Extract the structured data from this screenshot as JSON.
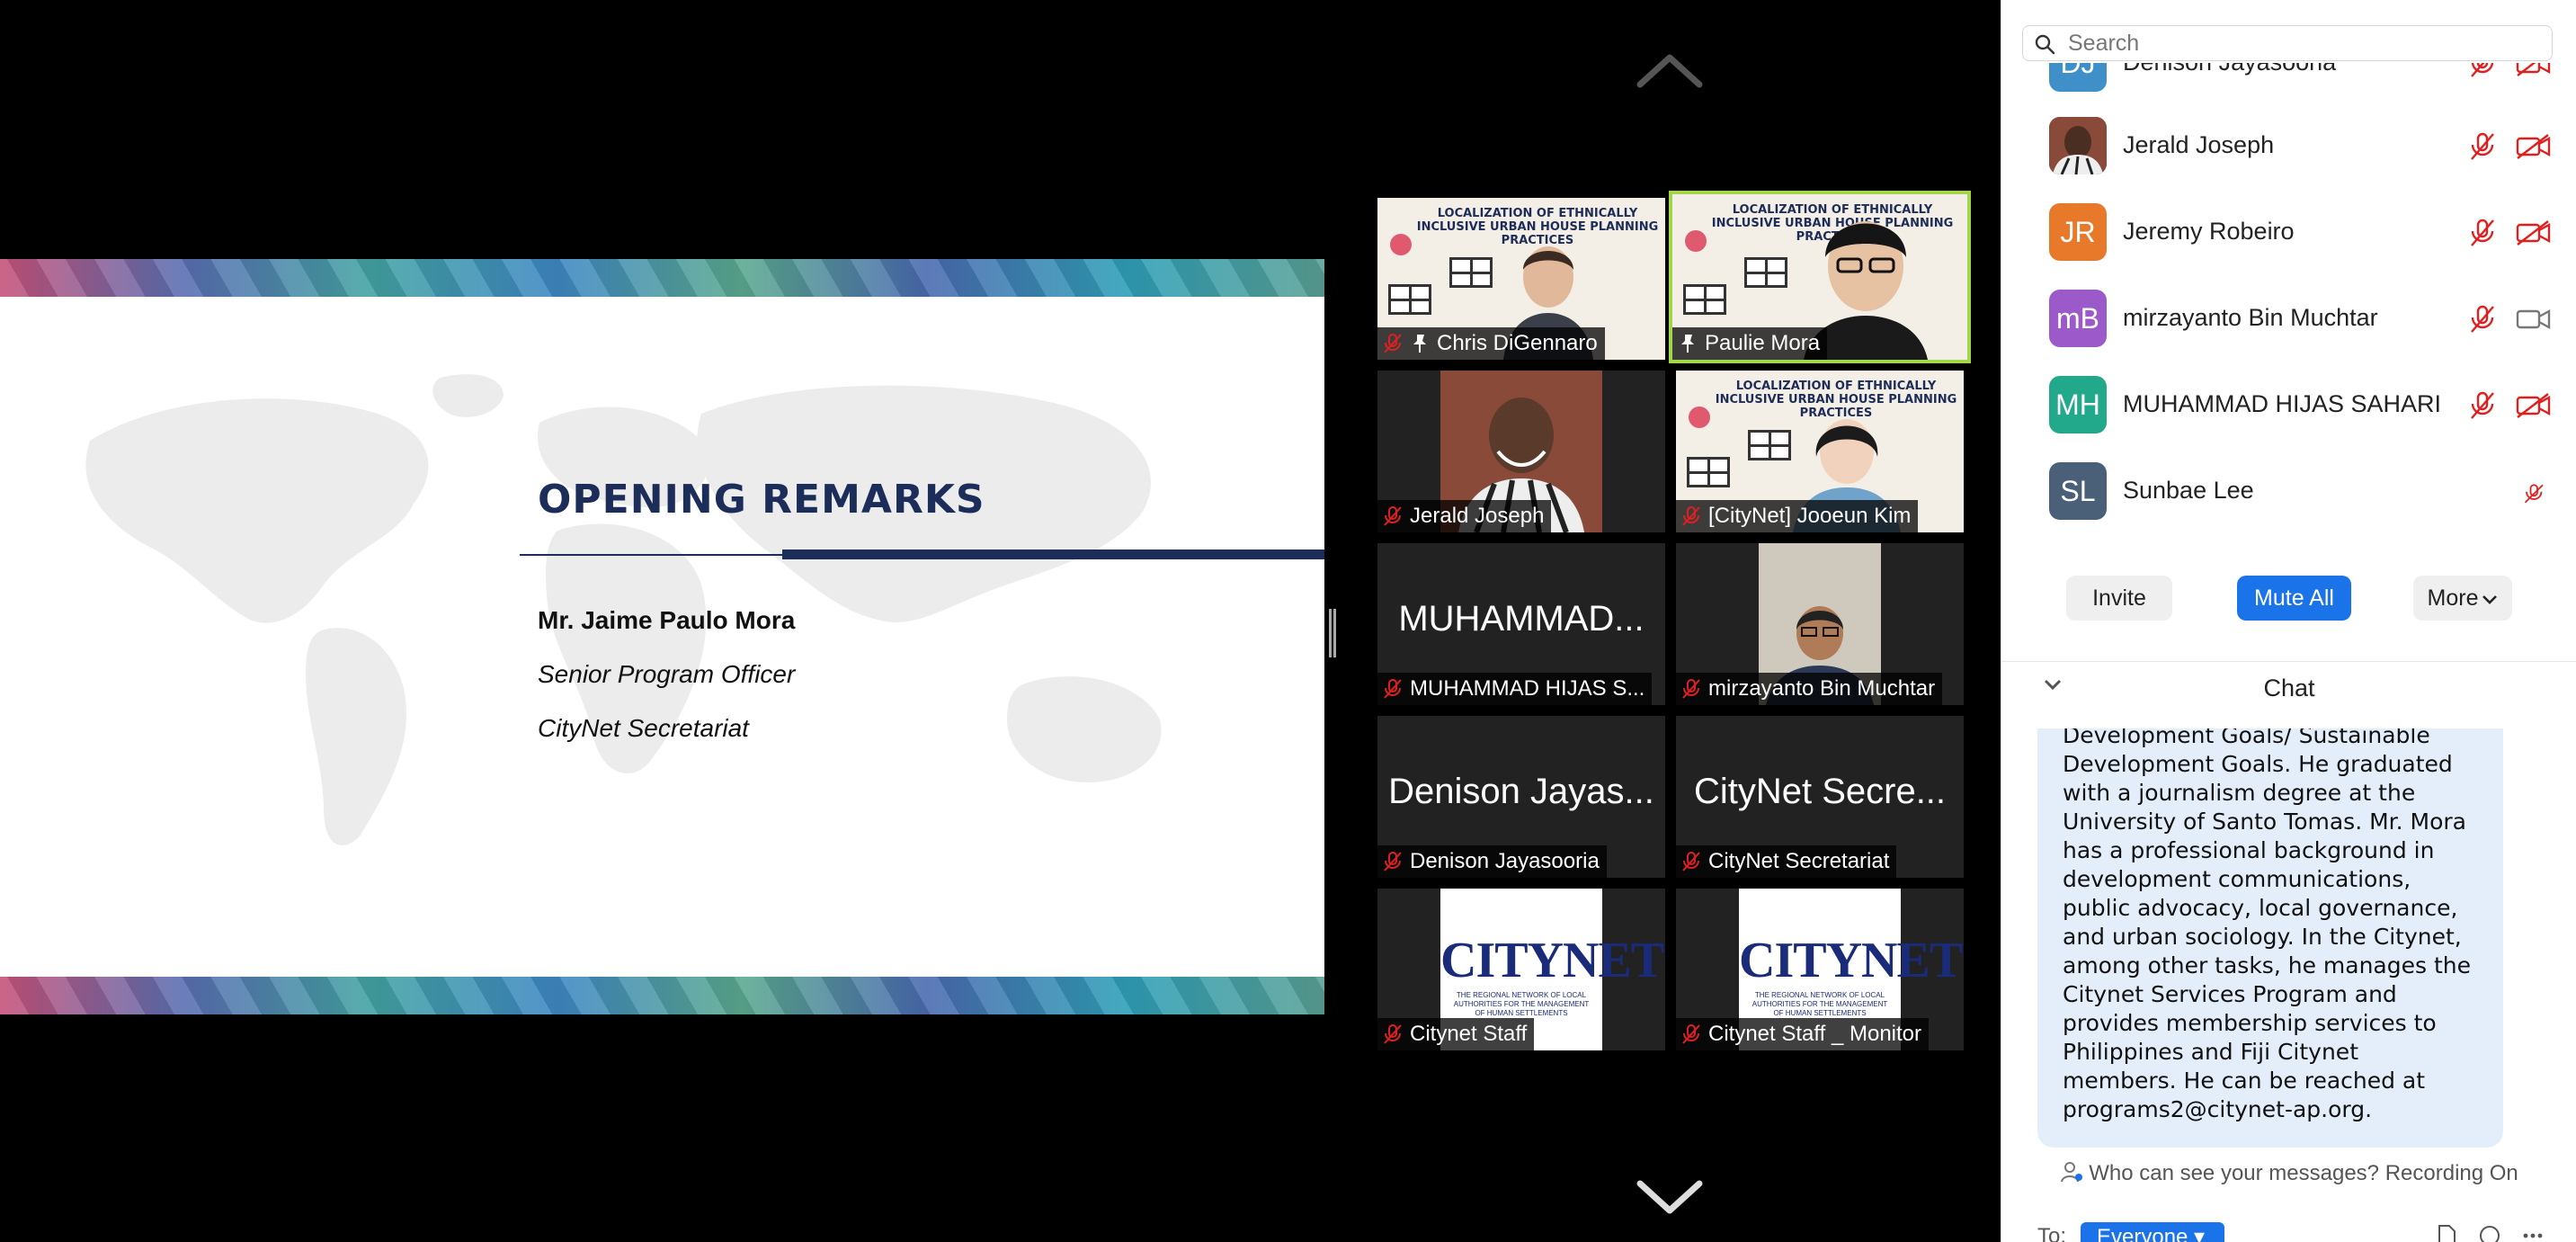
{
  "slide": {
    "title": "OPENING REMARKS",
    "speaker_name": "Mr. Jaime Paulo Mora",
    "speaker_role": "Senior Program Officer",
    "speaker_org": "CityNet Secretariat"
  },
  "gallery": {
    "tiles": [
      {
        "name": "Chris DiGennaro",
        "kind": "video-slide",
        "pinned": true,
        "muted": true
      },
      {
        "name": "Paulie Mora",
        "kind": "video-slide",
        "pinned": true,
        "muted": false,
        "active": true
      },
      {
        "name": "Jerald Joseph",
        "kind": "video",
        "muted": true
      },
      {
        "name": "[CityNet] Jooeun Kim",
        "kind": "video-slide",
        "muted": true
      },
      {
        "name": "MUHAMMAD HIJAS S...",
        "kind": "name-only",
        "big_name": "MUHAMMAD...",
        "muted": true
      },
      {
        "name": "mirzayanto Bin Muchtar",
        "kind": "video",
        "muted": true
      },
      {
        "name": "Denison Jayasooria",
        "kind": "name-only",
        "big_name": "Denison Jayas...",
        "muted": true
      },
      {
        "name": "CityNet Secretariat",
        "kind": "name-only",
        "big_name": "CityNet Secre...",
        "muted": true
      },
      {
        "name": "Citynet Staff",
        "kind": "logo",
        "muted": true
      },
      {
        "name": "Citynet Staff _ Monitor",
        "kind": "logo",
        "muted": true
      }
    ],
    "slide_thumb_title": "LOCALIZATION OF ETHNICALLY INCLUSIVE URBAN HOUSE PLANNING PRACTICES",
    "logo_word": "CITYNET",
    "logo_sub": "THE REGIONAL NETWORK OF LOCAL AUTHORITIES FOR THE MANAGEMENT OF HUMAN SETTLEMENTS"
  },
  "participants": {
    "search_placeholder": "Search",
    "items": [
      {
        "initials": "DJ",
        "name": "Denison Jayasooria",
        "color": "#3f8fc9",
        "mic": "off",
        "cam": "off"
      },
      {
        "initials": "",
        "name": "Jerald Joseph",
        "color": "#6b4a3a",
        "mic": "off",
        "cam": "off"
      },
      {
        "initials": "JR",
        "name": "Jeremy Robeiro",
        "color": "#e8782a",
        "mic": "off",
        "cam": "off"
      },
      {
        "initials": "mB",
        "name": "mirzayanto Bin Muchtar",
        "color": "#9b59c9",
        "mic": "off",
        "cam": "on"
      },
      {
        "initials": "MH",
        "name": "MUHAMMAD HIJAS SAHARI",
        "color": "#22a88a",
        "mic": "off",
        "cam": "off"
      },
      {
        "initials": "SL",
        "name": "Sunbae Lee",
        "color": "#4a5f78",
        "mic": "off",
        "cam": "none"
      }
    ],
    "invite_label": "Invite",
    "mute_all_label": "Mute All",
    "more_label": "More"
  },
  "chat": {
    "title": "Chat",
    "message": "Development Goals/ Sustainable Development Goals. He graduated with a journalism degree at the University of Santo Tomas. Mr. Mora has a professional background in development communications, public advocacy, local governance, and urban sociology. In the Citynet, among other tasks, he manages the Citynet Services Program and provides membership services to Philippines and Fiji Citynet members. He can be reached at programs2@citynet-ap.org.",
    "scope_text": "Who can see your messages? Recording On",
    "to_label": "To:",
    "to_value": "Everyone"
  },
  "colors": {
    "accent": "#1a73e8",
    "active_speaker": "#a3d74a",
    "muted_red": "#e02020",
    "slide_navy": "#1c2d5a"
  }
}
